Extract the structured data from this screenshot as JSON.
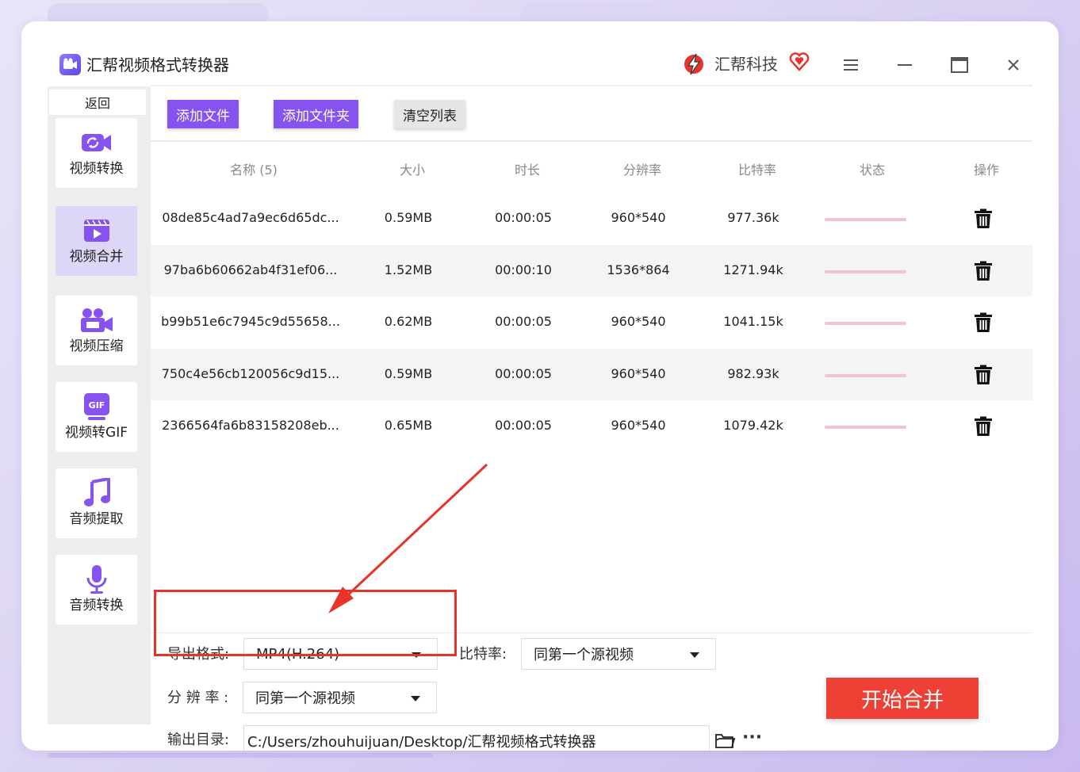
{
  "app": {
    "title": "汇帮视频格式转换器",
    "brand": "汇帮科技",
    "accent": "#8653ee"
  },
  "titlebar_icons": [
    "menu-icon",
    "minimize-icon",
    "maximize-icon",
    "close-icon"
  ],
  "sidebar": {
    "back": "返回",
    "items": [
      {
        "label": "视频转换",
        "icon": "video-convert-icon"
      },
      {
        "label": "视频合并",
        "icon": "video-merge-icon",
        "active": true
      },
      {
        "label": "视频压缩",
        "icon": "video-compress-icon"
      },
      {
        "label": "视频转GIF",
        "icon": "gif-icon"
      },
      {
        "label": "音频提取",
        "icon": "music-note-icon"
      },
      {
        "label": "音频转换",
        "icon": "microphone-icon"
      }
    ]
  },
  "toolbar": {
    "add_file": "添加文件",
    "add_folder": "添加文件夹",
    "clear_list": "清空列表"
  },
  "table": {
    "headers": [
      "名称 (5)",
      "大小",
      "时长",
      "分辨率",
      "比特率",
      "状态",
      "操作"
    ],
    "rows": [
      {
        "name": "08de85c4ad7a9ec6d65dc...",
        "size": "0.59MB",
        "duration": "00:00:05",
        "resolution": "960*540",
        "bitrate": "977.36k"
      },
      {
        "name": "97ba6b60662ab4f31ef06...",
        "size": "1.52MB",
        "duration": "00:00:10",
        "resolution": "1536*864",
        "bitrate": "1271.94k"
      },
      {
        "name": "b99b51e6c7945c9d55658...",
        "size": "0.62MB",
        "duration": "00:00:05",
        "resolution": "960*540",
        "bitrate": "1041.15k"
      },
      {
        "name": "750c4e56cb120056c9d15...",
        "size": "0.59MB",
        "duration": "00:00:05",
        "resolution": "960*540",
        "bitrate": "982.93k"
      },
      {
        "name": "2366564fa6b83158208eb...",
        "size": "0.65MB",
        "duration": "00:00:05",
        "resolution": "960*540",
        "bitrate": "1079.42k"
      }
    ]
  },
  "settings": {
    "format_label": "导出格式:",
    "format_value": "MP4(H.264)",
    "bitrate_label": "比特率:",
    "bitrate_value": "同第一个源视频",
    "resolution_label": "分 辨 率 :",
    "resolution_value": "同第一个源视频",
    "output_label": "输出目录:",
    "output_path": "C:/Users/zhouhuijuan/Desktop/汇帮视频格式转换器",
    "more": "···"
  },
  "start_button": "开始合并",
  "annotation_color": "#e8332b"
}
